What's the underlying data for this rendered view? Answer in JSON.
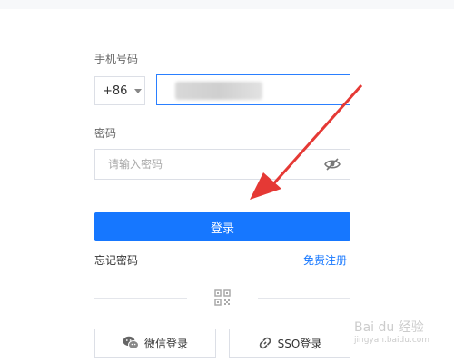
{
  "form": {
    "phone_label": "手机号码",
    "country_code": "+86",
    "password_label": "密码",
    "password_placeholder": "请输入密码",
    "login_button": "登录",
    "forgot_password": "忘记密码",
    "register": "免费注册",
    "wechat_login": "微信登录",
    "sso_login": "SSO登录"
  },
  "watermark": {
    "line1": "Bai du 经验",
    "line2": "jingyan.baidu.com"
  },
  "colors": {
    "primary": "#1677ff",
    "input_focus": "#2a7fff",
    "annotation_arrow": "#e53935"
  }
}
